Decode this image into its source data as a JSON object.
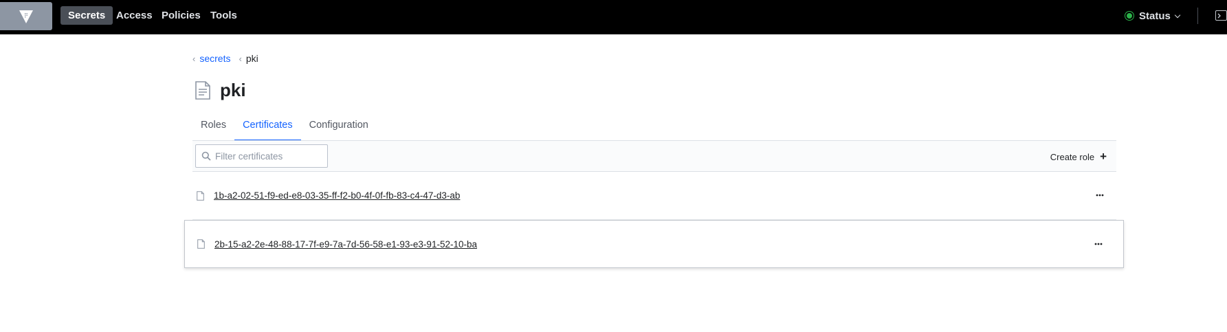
{
  "nav": {
    "items": [
      {
        "label": "Secrets",
        "active": true
      },
      {
        "label": "Access",
        "active": false
      },
      {
        "label": "Policies",
        "active": false
      },
      {
        "label": "Tools",
        "active": false
      }
    ],
    "status_label": "Status",
    "status_color": "#2cb34a",
    "logo_icon": "vault-logo-icon",
    "console_icon": "terminal-icon"
  },
  "breadcrumb": {
    "parent": "secrets",
    "current": "pki"
  },
  "page": {
    "title": "pki",
    "title_icon": "document-icon"
  },
  "tabs": [
    {
      "label": "Roles",
      "active": false
    },
    {
      "label": "Certificates",
      "active": true
    },
    {
      "label": "Configuration",
      "active": false
    }
  ],
  "toolbar": {
    "filter_placeholder": "Filter certificates",
    "filter_value": "",
    "create_label": "Create role",
    "create_icon": "plus-icon"
  },
  "certificates": [
    {
      "serial": "1b-a2-02-51-f9-ed-e8-03-35-ff-f2-b0-4f-0f-fb-83-c4-47-d3-ab"
    },
    {
      "serial": "2b-15-a2-2e-48-88-17-7f-e9-7a-7d-56-58-e1-93-e3-91-52-10-ba"
    }
  ],
  "colors": {
    "accent": "#1563ff",
    "topbar": "#000000"
  }
}
